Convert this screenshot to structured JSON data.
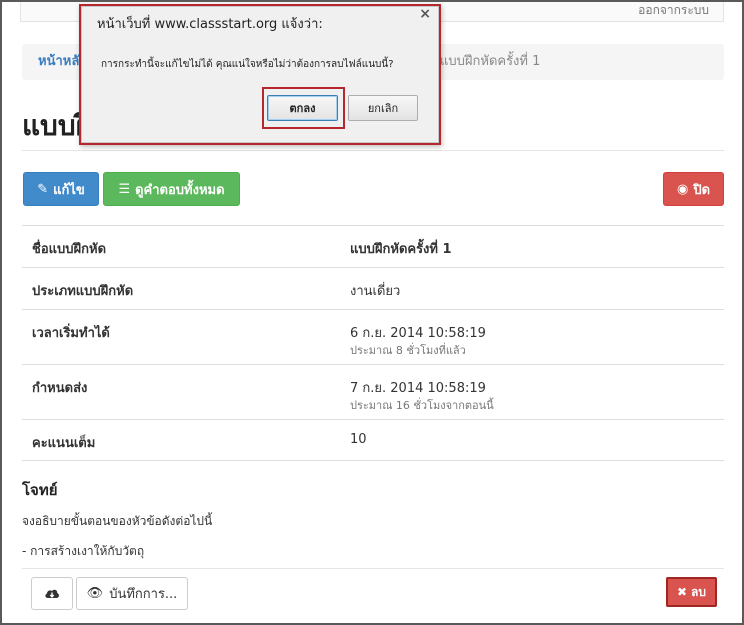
{
  "topbar": {
    "text": "ออกจากระบบ"
  },
  "breadcrumb": {
    "home": "หน้าหลัก",
    "current": "แบบฝึกหัดครั้งที่ 1"
  },
  "page": {
    "title": "แบบฝึกหัดครั้งที่ 1"
  },
  "actions": {
    "edit_label": "แก้ไข",
    "view_answers_label": "ดูคำตอบทั้งหมด",
    "close_label": "ปิด"
  },
  "details": {
    "rows": [
      {
        "key": "ชื่อแบบฝึกหัด",
        "value": "แบบฝึกหัดครั้งที่ 1",
        "sub": ""
      },
      {
        "key": "ประเภทแบบฝึกหัด",
        "value": "งานเดี่ยว",
        "sub": ""
      },
      {
        "key": "เวลาเริ่มทำได้",
        "value": "6 ก.ย. 2014 10:58:19",
        "sub": "ประมาณ 8 ชั่วโมงที่แล้ว"
      },
      {
        "key": "กำหนดส่ง",
        "value": "7 ก.ย. 2014 10:58:19",
        "sub": "ประมาณ 16 ชั่วโมงจากตอนนี้"
      },
      {
        "key": "คะแนนเต็ม",
        "value": "10",
        "sub": ""
      }
    ]
  },
  "problem": {
    "heading": "โจทย์",
    "line1": "จงอธิบายขั้นตอนของหัวข้อดังต่อไปนี้",
    "line2": "- การสร้างเงาให้กับวัตถุ"
  },
  "footer": {
    "save_label": "บันทึกการ...",
    "delete_label": "ลบ"
  },
  "dialog": {
    "title": "หน้าเว็บที่ www.classstart.org แจ้งว่า:",
    "message": "การกระทำนี้จะแก้ไขไม่ได้ คุณแน่ใจหรือไม่ว่าต้องการลบไฟล์แนบนี้?",
    "ok_label": "ตกลง",
    "cancel_label": "ยกเลิก",
    "close_glyph": "×"
  },
  "colors": {
    "primary": "#428bca",
    "success": "#5cb85c",
    "danger": "#d9534f",
    "highlight": "#b5272d"
  }
}
